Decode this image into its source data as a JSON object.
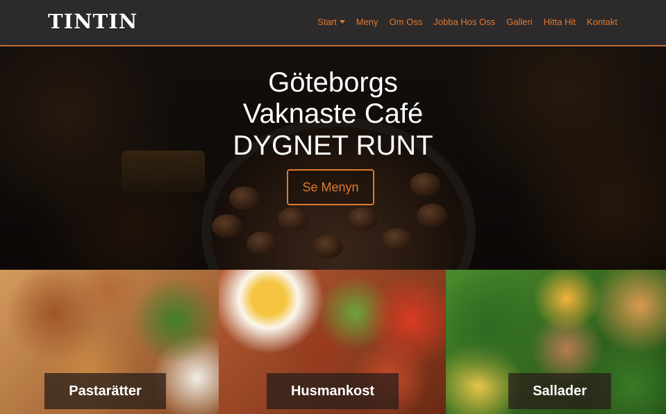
{
  "brand": "TINTIN",
  "nav": {
    "items": [
      "Start",
      "Meny",
      "Om Oss",
      "Jobba Hos Oss",
      "Galleri",
      "Hitta Hit",
      "Kontakt"
    ]
  },
  "hero": {
    "line1": "Göteborgs",
    "line2": "Vaknaste Café",
    "line3": "DYGNET RUNT",
    "cta": "Se Menyn"
  },
  "cards": [
    {
      "label": "Pastarätter"
    },
    {
      "label": "Husmankost"
    },
    {
      "label": "Sallader"
    }
  ],
  "colors": {
    "accent": "#e07a2e",
    "navbar": "#2d2a2b"
  }
}
